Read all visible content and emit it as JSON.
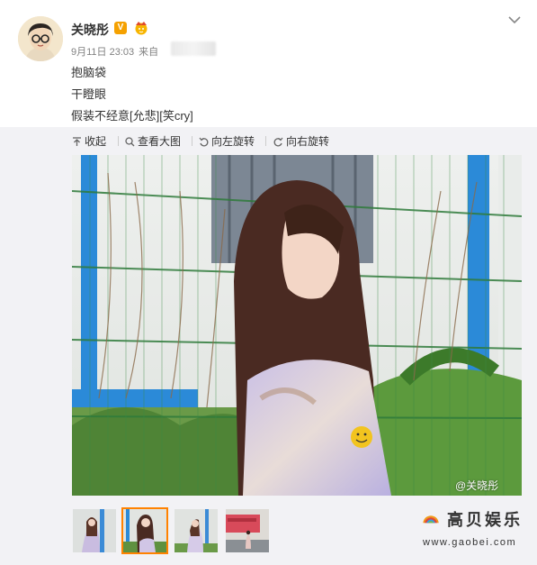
{
  "post": {
    "username": "关晓彤",
    "verified_badge": "V",
    "date": "9月11日 23:03",
    "source_label": "来自",
    "lines": [
      "抱脑袋",
      "干瞪眼",
      "假装不经意[允悲][笑cry]"
    ]
  },
  "toolbar": {
    "collapse": "收起",
    "view_large": "查看大图",
    "rotate_left": "向左旋转",
    "rotate_right": "向右旋转"
  },
  "photo": {
    "watermark": "@关晓彤"
  },
  "thumbnails": {
    "count": 4,
    "selected_index": 1
  },
  "site": {
    "logo_text": "高贝娱乐",
    "url": "www.gaobei.com"
  },
  "colors": {
    "accent": "#ff8200",
    "badge": "#f5a100",
    "gray_text": "#808080",
    "media_bg": "#f2f2f5"
  },
  "icons": [
    "chevron-down-icon",
    "collapse-icon",
    "search-icon",
    "rotate-left-icon",
    "rotate-right-icon"
  ]
}
